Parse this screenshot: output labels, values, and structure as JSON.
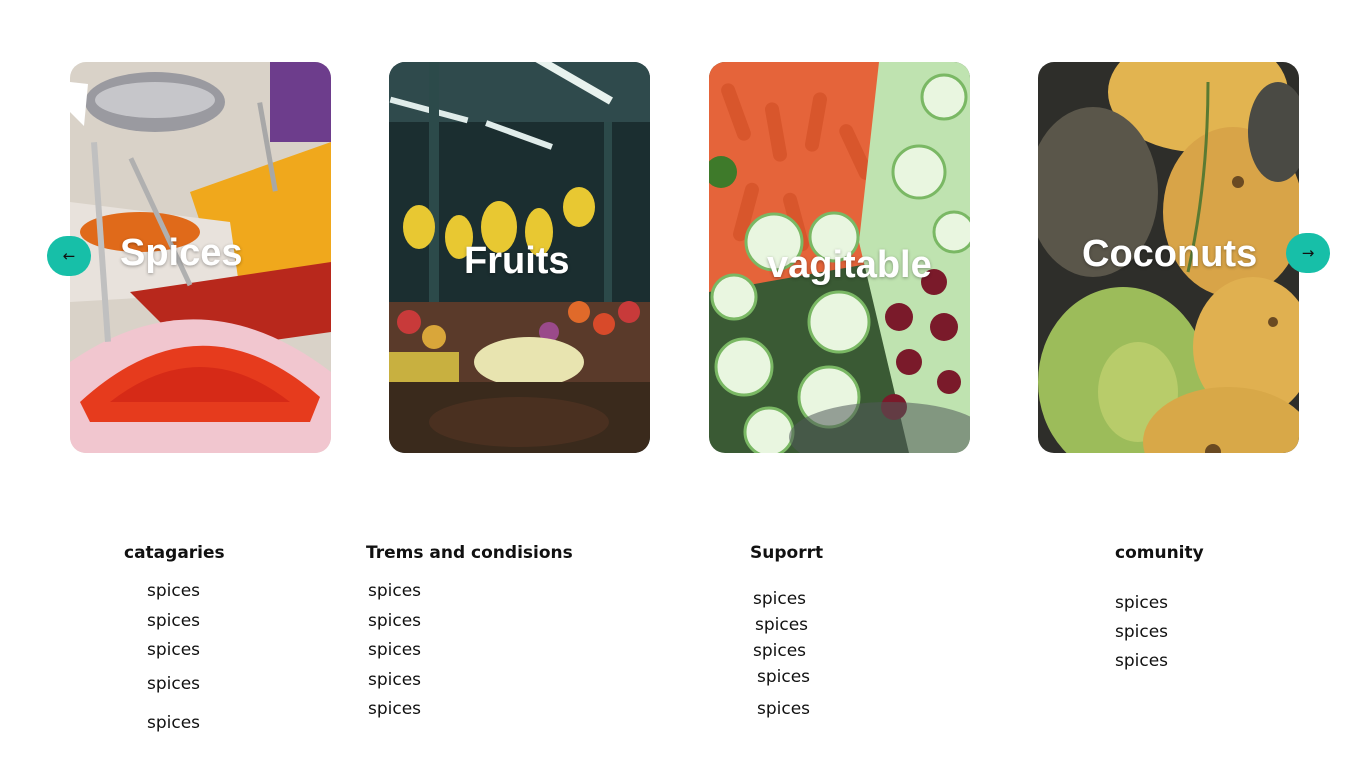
{
  "carousel": {
    "prev_icon": "←",
    "next_icon": "→",
    "cards": [
      {
        "title": "Spices"
      },
      {
        "title": "Fruits"
      },
      {
        "title": "vagitable"
      },
      {
        "title": "Coconuts"
      }
    ]
  },
  "footer": {
    "columns": [
      {
        "heading": "catagaries",
        "links": [
          "spices",
          "spices",
          "spices",
          "spices",
          "spices"
        ]
      },
      {
        "heading": "Trems and condisions",
        "links": [
          "spices",
          "spices",
          "spices",
          "spices",
          "spices"
        ]
      },
      {
        "heading": "Suporrt",
        "links": [
          "spices",
          "spices",
          "spices",
          "spices",
          "spices"
        ]
      },
      {
        "heading": "comunity",
        "links": [
          "spices",
          "spices",
          "spices"
        ]
      }
    ]
  },
  "colors": {
    "accent": "#17bfa8"
  }
}
